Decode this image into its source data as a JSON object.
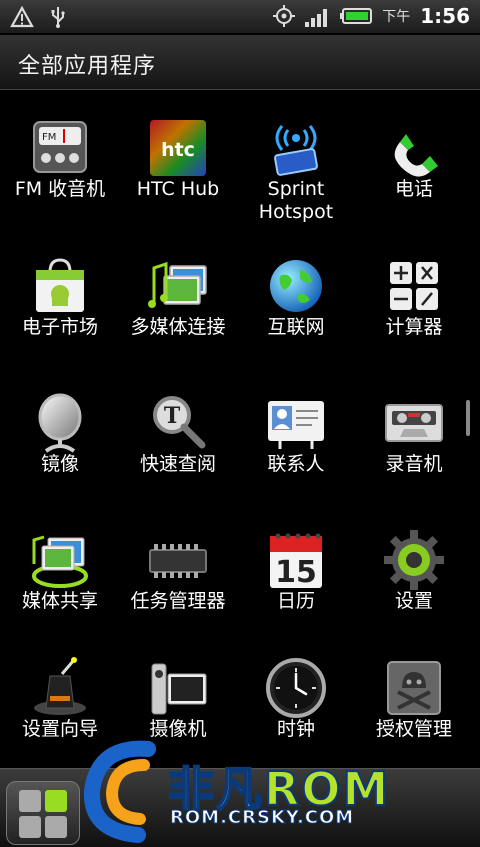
{
  "status_bar": {
    "left_icons": [
      "warning-icon",
      "usb-icon"
    ],
    "right_icons": [
      "gps-icon",
      "signal-icon",
      "battery-icon"
    ],
    "ampm": "下午",
    "time": "1:56"
  },
  "header": {
    "title": "全部应用程序"
  },
  "apps": [
    {
      "label": "FM 收音机",
      "icon": "fm-radio-icon"
    },
    {
      "label": "HTC Hub",
      "icon": "htc-hub-icon"
    },
    {
      "label": "Sprint Hotspot",
      "icon": "hotspot-icon"
    },
    {
      "label": "电话",
      "icon": "phone-icon"
    },
    {
      "label": "电子市场",
      "icon": "market-icon"
    },
    {
      "label": "多媒体连接",
      "icon": "media-link-icon"
    },
    {
      "label": "互联网",
      "icon": "globe-icon"
    },
    {
      "label": "计算器",
      "icon": "calculator-icon"
    },
    {
      "label": "镜像",
      "icon": "mirror-icon"
    },
    {
      "label": "快速查阅",
      "icon": "quick-lookup-icon"
    },
    {
      "label": "联系人",
      "icon": "contacts-icon"
    },
    {
      "label": "录音机",
      "icon": "recorder-icon"
    },
    {
      "label": "媒体共享",
      "icon": "media-share-icon"
    },
    {
      "label": "任务管理器",
      "icon": "task-manager-icon"
    },
    {
      "label": "日历",
      "icon": "calendar-icon",
      "day": "15"
    },
    {
      "label": "设置",
      "icon": "settings-gear-icon"
    },
    {
      "label": "设置向导",
      "icon": "setup-wizard-icon"
    },
    {
      "label": "摄像机",
      "icon": "camcorder-icon"
    },
    {
      "label": "时钟",
      "icon": "clock-icon"
    },
    {
      "label": "授权管理",
      "icon": "superuser-icon"
    }
  ],
  "watermark": {
    "brand_a": "非凡",
    "brand_b": "ROM",
    "url": "ROM.CRSKY.COM"
  },
  "colors": {
    "accent_green": "#b6e22e",
    "watermark_blue": "#0a3a7a"
  }
}
